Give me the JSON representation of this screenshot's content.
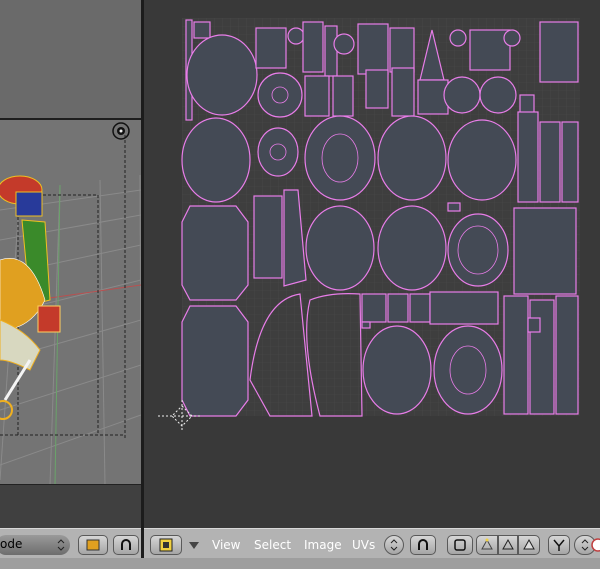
{
  "uv_header": {
    "menus": [
      "View",
      "Select",
      "Image",
      "UVs"
    ]
  },
  "viewport_header": {
    "mode_label": "ode"
  },
  "icons": {
    "editor_type": "uv-image-editor-icon",
    "pivot": "pivot-icon",
    "snap": "snap-magnet-icon",
    "sync": "uv-sync-icon",
    "select_vertex": "vertex-select-icon",
    "select_edge": "edge-select-icon",
    "select_face": "face-select-icon",
    "sticky": "sticky-select-icon"
  },
  "colors": {
    "uv_wire": "#e87de8",
    "uv_face": "#444a55",
    "grid": "#4a4a4a",
    "header": "#b3b3b3"
  }
}
